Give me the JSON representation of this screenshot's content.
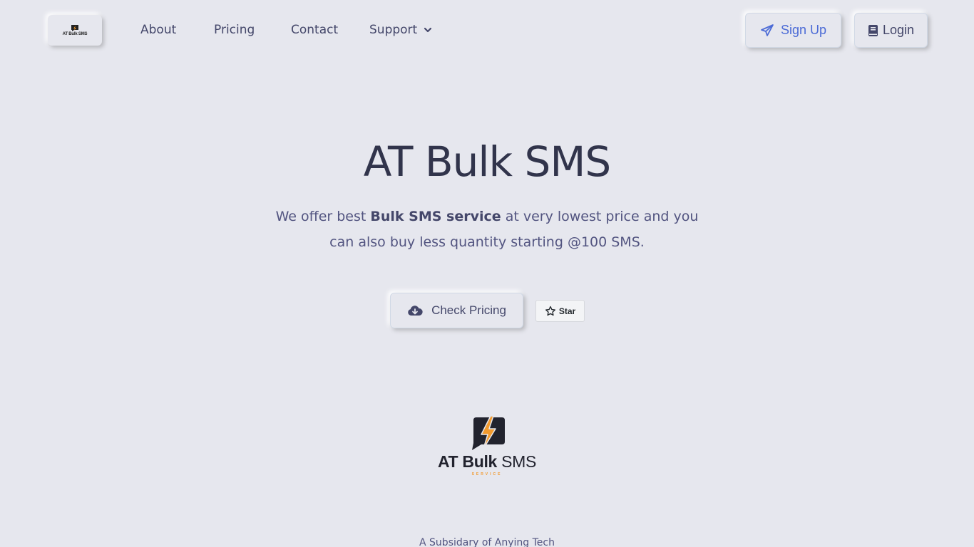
{
  "nav": {
    "brand_mini_text": "AT Bulk SMS",
    "links": {
      "about": "About",
      "pricing": "Pricing",
      "contact": "Contact",
      "support": "Support"
    },
    "signup_label": "Sign Up",
    "login_label": "Login"
  },
  "hero": {
    "title": "AT Bulk SMS",
    "subtitle_pre": "We offer best ",
    "subtitle_bold": "Bulk SMS service",
    "subtitle_post": " at very lowest price and you can also buy less quantity starting @100 SMS.",
    "check_pricing_label": "Check Pricing",
    "star_label": "Star"
  },
  "logo": {
    "text_bold": "AT Bulk",
    "text_regular": " SMS",
    "sub": "SERVICE"
  },
  "footer": {
    "text": "A Subsidary of Anying Tech"
  },
  "colors": {
    "background": "#e6e7ee",
    "accent_blue": "#4c6bd6",
    "logo_orange": "#f29a2e",
    "text_dark": "#31344b"
  },
  "icons": {
    "signup": "paper-plane-icon",
    "login": "book-icon",
    "check_pricing": "cloud-download-icon",
    "star": "star-outline-icon",
    "support": "chevron-down-icon"
  }
}
